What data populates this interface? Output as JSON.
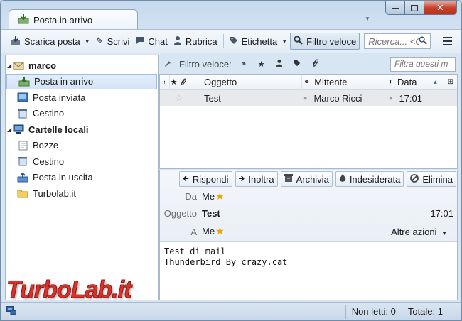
{
  "window": {
    "tab_title": "Posta in arrivo",
    "list_tabs_icon": "chevron-down-icon",
    "minimize_icon": "minimize-icon",
    "maximize_icon": "maximize-icon",
    "close_icon": "close-icon"
  },
  "toolbar": {
    "get_mail": "Scarica posta",
    "write": "Scrivi",
    "chat": "Chat",
    "address_book": "Rubrica",
    "tag": "Etichetta",
    "quick_filter": "Filtro veloce",
    "search_placeholder": "Ricerca... <C"
  },
  "folders": [
    {
      "label": "marco",
      "type": "account",
      "icon": "mail-account-icon"
    },
    {
      "label": "Posta in arrivo",
      "type": "folder",
      "icon": "inbox-icon",
      "selected": true
    },
    {
      "label": "Posta inviata",
      "type": "folder",
      "icon": "sent-icon"
    },
    {
      "label": "Cestino",
      "type": "folder",
      "icon": "trash-icon"
    },
    {
      "label": "Cartelle locali",
      "type": "account",
      "icon": "local-folders-icon"
    },
    {
      "label": "Bozze",
      "type": "folder",
      "icon": "drafts-icon"
    },
    {
      "label": "Cestino",
      "type": "folder",
      "icon": "trash-icon"
    },
    {
      "label": "Posta in uscita",
      "type": "folder",
      "icon": "outbox-icon"
    },
    {
      "label": "Turbolab.it",
      "type": "folder",
      "icon": "folder-icon"
    }
  ],
  "quick_filter_bar": {
    "label": "Filtro veloce:",
    "filter_placeholder": "Filtra questi m"
  },
  "thread_list": {
    "columns": [
      "Oggetto",
      "Mittente",
      "Data"
    ],
    "rows": [
      {
        "subject": "Test",
        "sender": "Marco Ricci",
        "date": "17:01",
        "starred": false
      }
    ]
  },
  "message_header": {
    "actions": [
      "Rispondi",
      "Inoltra",
      "Archivia",
      "Indesiderata",
      "Elimina"
    ],
    "from_label": "Da",
    "from_value": "Me",
    "subject_label": "Oggetto",
    "subject_value": "Test",
    "time": "17:01",
    "to_label": "A",
    "to_value": "Me",
    "other_actions": "Altre azioni"
  },
  "message_body": "Test di mail\nThunderbird By crazy.cat",
  "status_bar": {
    "unread": "Non letti: 0",
    "total": "Totale: 1"
  },
  "watermark": "TurboLab.it",
  "colors": {
    "watermark": "#e11d16",
    "star": "#e6a700",
    "close_button": "#c7402b"
  }
}
